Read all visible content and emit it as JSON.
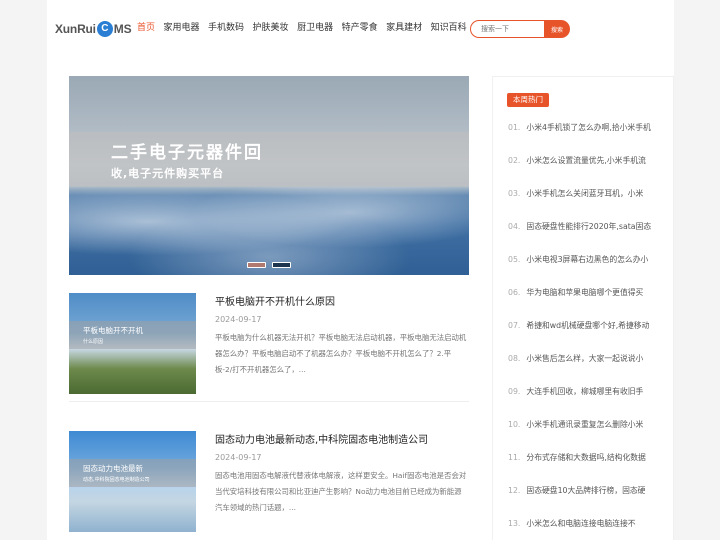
{
  "logo": {
    "pre": "XunRui",
    "c": "C",
    "post": "MS"
  },
  "nav": [
    {
      "label": "首页",
      "active": true
    },
    {
      "label": "家用电器"
    },
    {
      "label": "手机数码"
    },
    {
      "label": "护肤美妆"
    },
    {
      "label": "厨卫电器"
    },
    {
      "label": "特产零食"
    },
    {
      "label": "家具建材"
    },
    {
      "label": "知识百科"
    }
  ],
  "search": {
    "placeholder": "搜索一下",
    "button": "搜索"
  },
  "banner": {
    "line1": "二手电子元器件回",
    "line2": "收,电子元件购买平台"
  },
  "articles": [
    {
      "title": "平板电脑开不开机什么原因",
      "date": "2024-09-17",
      "desc": "平板电脑为什么机器无法开机？平板电脑无法启动机器，平板电脑无法启动机器怎么办？平板电脑启动不了机器怎么办？平板电脑不开机怎么了？2.平板-2/打不开机器怎么了，...",
      "thumb_caption1": "平板电脑开不开机",
      "thumb_caption2": "什么原因"
    },
    {
      "title": "固态动力电池最新动态,中科院固态电池制造公司",
      "date": "2024-09-17",
      "desc": "固态电池用固态电解液代替液体电解液，这样更安全。Haif固态电池是否会对当代安培科技有限公司和比亚迪产生影响？No动力电池目前已经成为新能源汽车领域的热门话题，...",
      "thumb_caption1": "固态动力电池最新",
      "thumb_caption2": "动态,中科院固态电池制造公司"
    }
  ],
  "sidebar": {
    "title": "本周热门",
    "items": [
      {
        "num": "01.",
        "text": "小米4手机锁了怎么办啊,拾小米手机"
      },
      {
        "num": "02.",
        "text": "小米怎么设置流量优先,小米手机流"
      },
      {
        "num": "03.",
        "text": "小米手机怎么关闭蓝牙耳机，小米"
      },
      {
        "num": "04.",
        "text": "固态硬盘性能排行2020年,sata固态"
      },
      {
        "num": "05.",
        "text": "小米电视3屏幕右边黑色的怎么办小"
      },
      {
        "num": "06.",
        "text": "华为电脑和苹果电脑哪个更值得买"
      },
      {
        "num": "07.",
        "text": "希捷和wd机械硬盘哪个好,希捷移动"
      },
      {
        "num": "08.",
        "text": "小米售后怎么样，大家一起说说小"
      },
      {
        "num": "09.",
        "text": "大连手机回收，柳城哪里有收旧手"
      },
      {
        "num": "10.",
        "text": "小米手机通讯录重复怎么删除小米"
      },
      {
        "num": "11.",
        "text": "分布式存储和大数据吗,结构化数据"
      },
      {
        "num": "12.",
        "text": "固态硬盘10大品牌排行榜，固态硬"
      },
      {
        "num": "13.",
        "text": "小米怎么和电脑连接电脑连接不"
      }
    ]
  }
}
